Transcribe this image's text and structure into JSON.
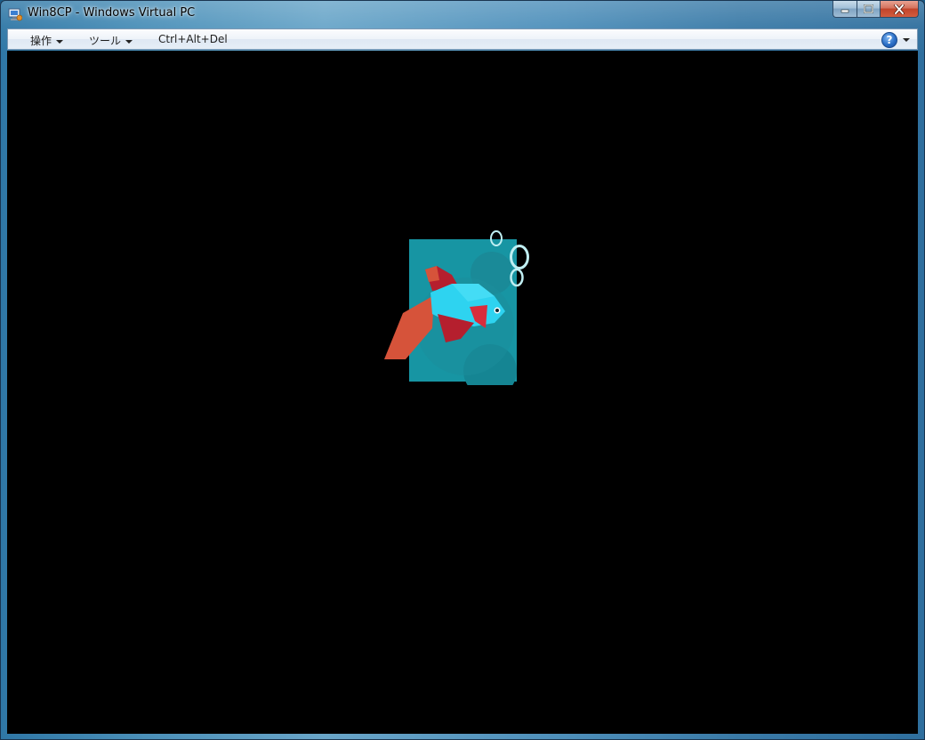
{
  "window": {
    "title": "Win8CP - Windows Virtual PC",
    "app_icon": "virtual-pc-icon",
    "controls": {
      "minimize_icon": "minimize-icon",
      "maximize_icon": "maximize-icon",
      "close_icon": "close-icon"
    }
  },
  "menu": {
    "items": [
      {
        "label": "操作",
        "has_dropdown": true
      },
      {
        "label": "ツール",
        "has_dropdown": true
      },
      {
        "label": "Ctrl+Alt+Del",
        "has_dropdown": false
      }
    ],
    "help": {
      "icon": "help-icon",
      "glyph": "?",
      "has_dropdown": true
    }
  },
  "screen": {
    "background": "#000000",
    "content": "betta-fish-boot-logo",
    "colors": {
      "panel": "#1795a3",
      "panel_shade": "#1a8a98",
      "fish_body": "#2ed3f0",
      "fish_red": "#b51f2e",
      "fish_orange": "#d6533a",
      "bubbles": "#bfeef2"
    }
  }
}
